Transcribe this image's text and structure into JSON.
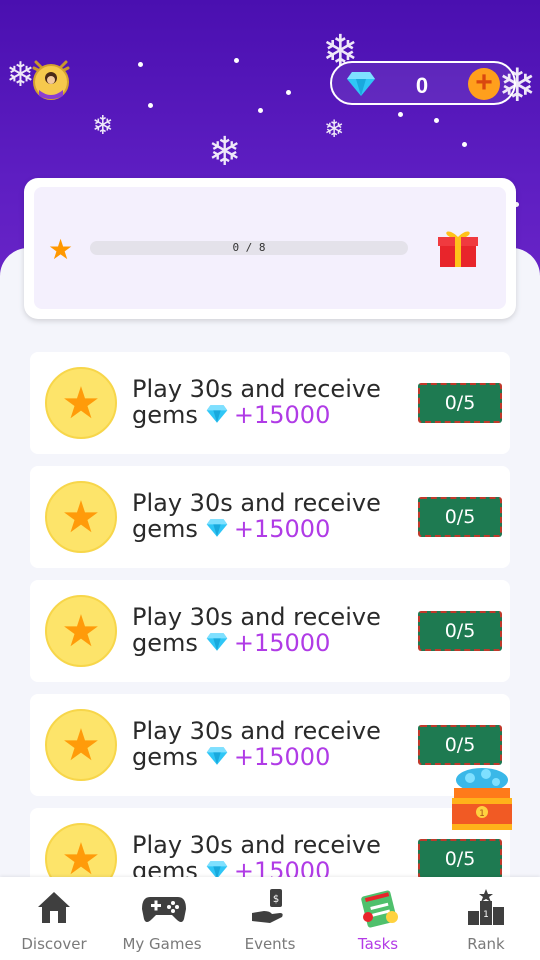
{
  "header": {
    "gem_count": "0",
    "plus_label": "+"
  },
  "progress": {
    "text": "0 / 8",
    "current": 0,
    "total": 8
  },
  "tasks": [
    {
      "line1": "Play 30s and receive",
      "line2": "gems",
      "reward": "+15000",
      "status": "0/5"
    },
    {
      "line1": "Play 30s and receive",
      "line2": "gems",
      "reward": "+15000",
      "status": "0/5"
    },
    {
      "line1": "Play 30s and receive",
      "line2": "gems",
      "reward": "+15000",
      "status": "0/5"
    },
    {
      "line1": "Play 30s and receive",
      "line2": "gems",
      "reward": "+15000",
      "status": "0/5"
    },
    {
      "line1": "Play 30s and receive",
      "line2": "gems",
      "reward": "+15000",
      "status": "0/5"
    }
  ],
  "nav": [
    {
      "label": "Discover",
      "icon": "home-icon"
    },
    {
      "label": "My Games",
      "icon": "gamepad-icon"
    },
    {
      "label": "Events",
      "icon": "money-hand-icon"
    },
    {
      "label": "Tasks",
      "icon": "tasks-icon"
    },
    {
      "label": "Rank",
      "icon": "podium-icon"
    }
  ],
  "colors": {
    "header": "#5519b8",
    "accent_purple": "#b33be6",
    "badge_green": "#1e7a51",
    "star_orange": "#ff9800"
  }
}
